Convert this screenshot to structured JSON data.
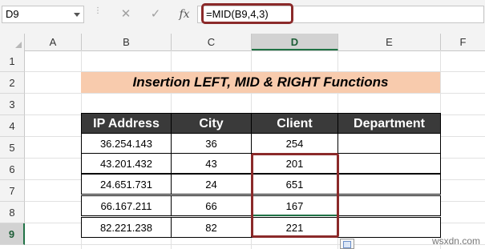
{
  "formula_bar": {
    "name_box": "D9",
    "cancel_glyph": "✕",
    "enter_glyph": "✓",
    "fx_label": "fx",
    "formula": "=MID(B9,4,3)"
  },
  "columns": [
    "A",
    "B",
    "C",
    "D",
    "E",
    "F"
  ],
  "active_column": "D",
  "rows": [
    "1",
    "2",
    "3",
    "4",
    "5",
    "6",
    "7",
    "8",
    "9"
  ],
  "active_row": "9",
  "sheet": {
    "title": "Insertion LEFT, MID & RIGHT Functions",
    "title_bg": "#f8cbad",
    "header_bg": "#3a3a3a",
    "highlight_color": "#8b2a2a",
    "headers": [
      "IP Address",
      "City",
      "Client",
      "Department"
    ],
    "rows": [
      [
        "36.254.143",
        "36",
        "254",
        ""
      ],
      [
        "43.201.432",
        "43",
        "201",
        ""
      ],
      [
        "24.651.731",
        "24",
        "651",
        ""
      ],
      [
        "66.167.211",
        "66",
        "167",
        ""
      ],
      [
        "82.221.238",
        "82",
        "221",
        ""
      ]
    ]
  },
  "watermark": "wsxdn.com"
}
